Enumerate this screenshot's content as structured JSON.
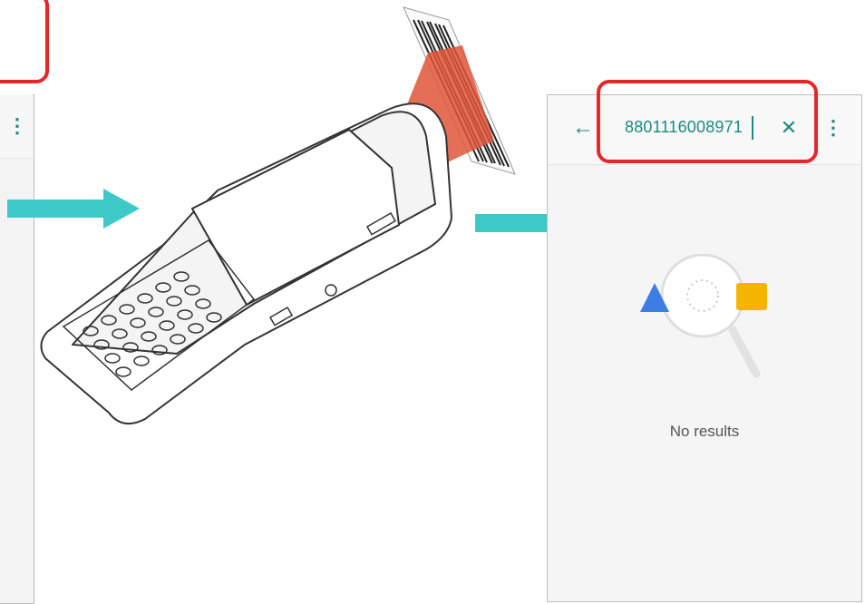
{
  "right_screen": {
    "search_query": "8801116008971",
    "back_icon": "arrow-left-icon",
    "clear_icon": "close-icon",
    "menu_icon": "more-vertical-icon",
    "empty_state_text": "No results"
  },
  "left_screen": {
    "menu_icon": "more-vertical-icon"
  },
  "colors": {
    "accent": "#1b8a80",
    "highlight": "#e5262a",
    "arrow": "#3ec9c9",
    "laser": "#e0553a"
  }
}
